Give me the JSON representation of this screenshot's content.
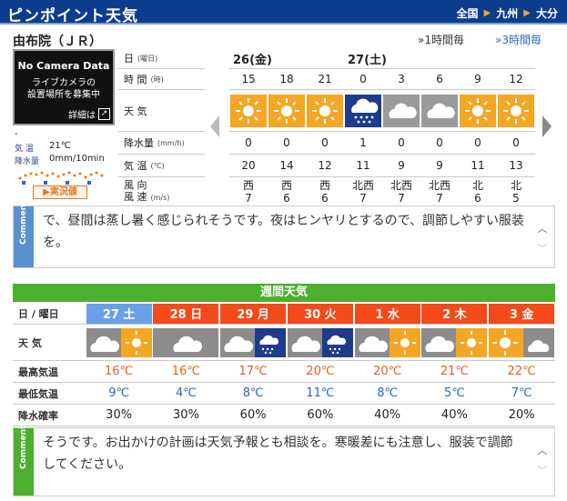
{
  "header": {
    "title": "ピンポイント天気",
    "breadcrumb": [
      "全国",
      "九州",
      "大分"
    ]
  },
  "location": {
    "name": "由布院（ＪＲ）",
    "step_1h": "1時間毎",
    "step_3h": "3時間毎"
  },
  "camera": {
    "title": "No Camera Data",
    "line1": "ライブカメラの",
    "line2": "設置場所を募集中",
    "detail": "詳細は"
  },
  "observation": {
    "dash": "-",
    "temp_label": "気 温",
    "temp_value": "21℃",
    "precip_label": "降水量",
    "precip_value": "0mm/10min",
    "jikkyo": "実況値"
  },
  "hourly": {
    "labels": {
      "date": "日",
      "date_sub": "(曜日)",
      "time": "時 間",
      "time_sub": "(時)",
      "weather": "天 気",
      "precip": "降水量",
      "precip_sub": "(mm/h)",
      "temp": "気 温",
      "temp_sub": "(℃)",
      "wind_dir": "風 向",
      "wind_spd": "風 速",
      "wind_sub": "(m/s)"
    },
    "dates": [
      "26(金)",
      "27(土)"
    ],
    "hours": [
      "15",
      "18",
      "21",
      "0",
      "3",
      "6",
      "9",
      "12"
    ],
    "weather": [
      "sun-icon",
      "sun-icon",
      "sun-icon",
      "rain-icon",
      "cloud-icon",
      "cloud-icon",
      "sun-icon",
      "sun-icon"
    ],
    "precip": [
      "0",
      "0",
      "0",
      "1",
      "0",
      "0",
      "0",
      "0"
    ],
    "temp": [
      "20",
      "14",
      "12",
      "11",
      "9",
      "9",
      "11",
      "13"
    ],
    "wind_dir": [
      "西",
      "西",
      "西",
      "北西",
      "北西",
      "北西",
      "北",
      "北"
    ],
    "wind_spd": [
      "7",
      "6",
      "6",
      "7",
      "7",
      "7",
      "6",
      "5"
    ]
  },
  "comment1": {
    "tab": "Comment",
    "text": "で、昼間は蒸し暑く感じられそうです。夜はヒンヤリとするので、調節しやすい服装を。"
  },
  "weekly": {
    "title": "週間天気",
    "labels": {
      "day": "日 / 曜日",
      "weather": "天 気",
      "max": "最高気温",
      "min": "最低気温",
      "rain": "降水確率"
    },
    "days": [
      "27 土",
      "28 日",
      "29 月",
      "30 火",
      "1 水",
      "2 木",
      "3 金"
    ],
    "day_colors": [
      "#6aa0e8",
      "#f24a1a",
      "#f24a1a",
      "#f24a1a",
      "#f24a1a",
      "#f24a1a",
      "#f24a1a"
    ],
    "weather": [
      "cloud-sun-icon",
      "cloud-icon",
      "cloud-rain-icon",
      "cloud-rain-icon",
      "cloud-sun-icon",
      "cloud-sun-icon",
      "sun-cloud-icon"
    ],
    "max": [
      "16℃",
      "16℃",
      "17℃",
      "20℃",
      "20℃",
      "21℃",
      "22℃"
    ],
    "min": [
      "9℃",
      "4℃",
      "8℃",
      "11℃",
      "8℃",
      "5℃",
      "7℃"
    ],
    "rain": [
      "30%",
      "30%",
      "60%",
      "60%",
      "40%",
      "40%",
      "20%"
    ]
  },
  "comment2": {
    "tab": "Comment",
    "text": "そうです。お出かけの計画は天気予報とも相談を。寒暖差にも注意し、服装で調節してください。"
  },
  "colors": {
    "header": "#0c3c8c",
    "sun_bg": "#f5a623",
    "rain_bg": "#1e3c8c",
    "cloud_bg": "#9a9a9a",
    "max": "#e2601d",
    "min": "#2a66c8",
    "week_green": "#4caf2d"
  }
}
